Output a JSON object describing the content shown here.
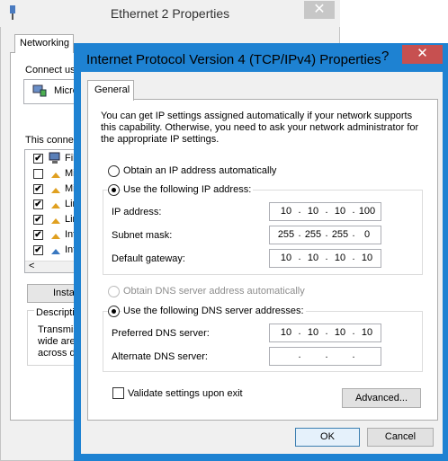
{
  "bg_window": {
    "title": "Ethernet 2 Properties",
    "close_glyph": "✕",
    "tab": "Networking",
    "connect_using": "Connect us",
    "component": "Micro",
    "this_connection": "This conne",
    "items": [
      {
        "checked": true,
        "label": "File"
      },
      {
        "checked": false,
        "label": "Mi"
      },
      {
        "checked": true,
        "label": "Mi"
      },
      {
        "checked": true,
        "label": "Lin"
      },
      {
        "checked": true,
        "label": "Lin"
      },
      {
        "checked": true,
        "label": "Int"
      },
      {
        "checked": true,
        "label": "Int"
      }
    ],
    "scroll_left": "<",
    "install": "Insta",
    "description_title": "Descriptio",
    "description_lines": [
      "Transmis",
      "wide area",
      "across di"
    ]
  },
  "dialog": {
    "title": "Internet Protocol Version 4 (TCP/IPv4) Properties",
    "help_glyph": "?",
    "close_glyph": "✕",
    "tab": "General",
    "intro": "You can get IP settings assigned automatically if your network supports this capability. Otherwise, you need to ask your network administrator for the appropriate IP settings.",
    "ip_auto": "Obtain an IP address automatically",
    "ip_manual": "Use the following IP address:",
    "ip_address_label": "IP address:",
    "ip_address": [
      "10",
      "10",
      "10",
      "100"
    ],
    "subnet_label": "Subnet mask:",
    "subnet": [
      "255",
      "255",
      "255",
      "0"
    ],
    "gateway_label": "Default gateway:",
    "gateway": [
      "10",
      "10",
      "10",
      "10"
    ],
    "dns_auto": "Obtain DNS server address automatically",
    "dns_manual": "Use the following DNS server addresses:",
    "preferred_label": "Preferred DNS server:",
    "preferred": [
      "10",
      "10",
      "10",
      "10"
    ],
    "alternate_label": "Alternate DNS server:",
    "alternate": [
      "",
      "",
      "",
      ""
    ],
    "validate": "Validate settings upon exit",
    "advanced": "Advanced...",
    "ok": "OK",
    "cancel": "Cancel"
  },
  "colors": {
    "dialog_frame": "#1e82d2",
    "close_button": "#c75050"
  }
}
